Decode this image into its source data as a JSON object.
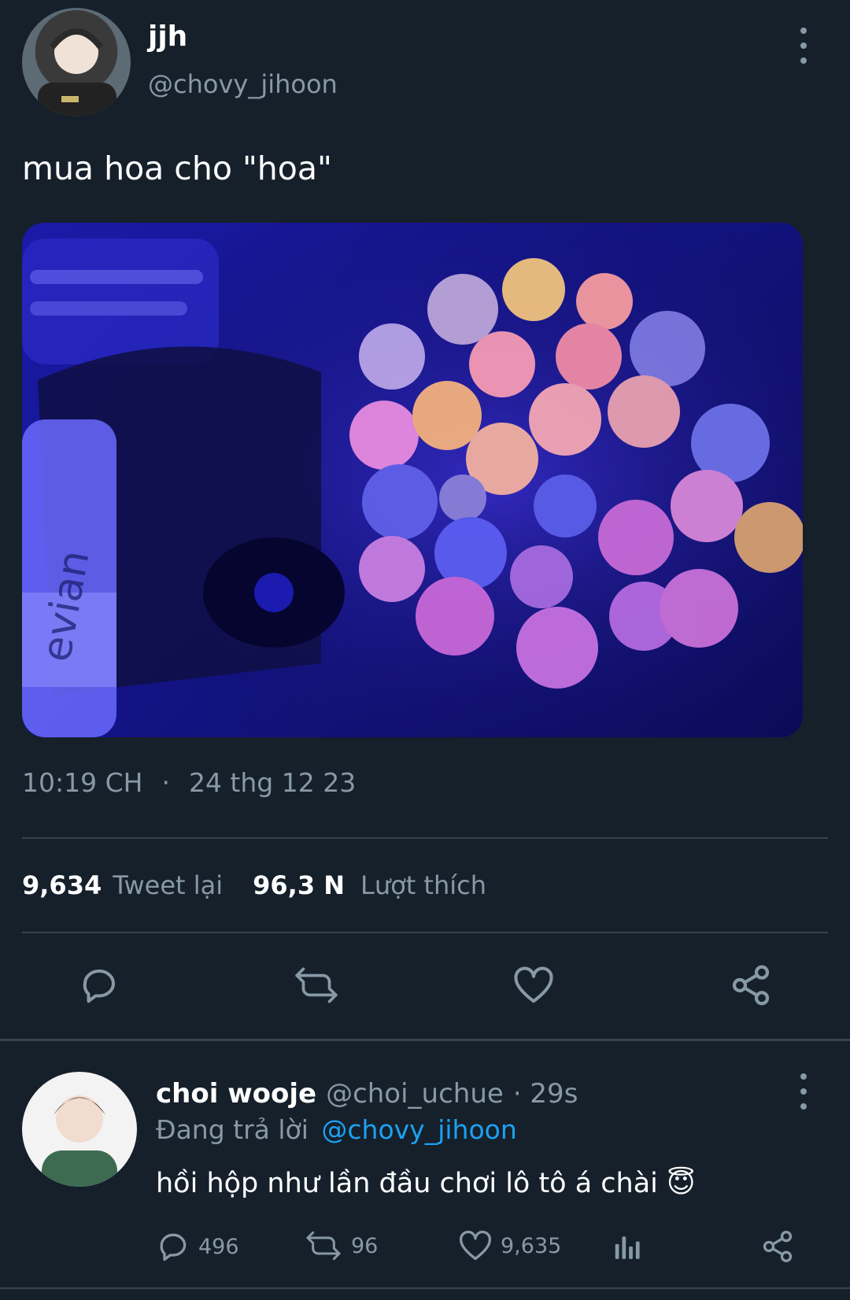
{
  "tweet": {
    "author_name": "jjh",
    "author_handle": "@chovy_jihoon",
    "text": "mua hoa cho \"hoa\"",
    "time": "10:19 CH",
    "separator": "·",
    "date": "24 thg 12 23",
    "retweets_count": "9,634",
    "retweets_label": "Tweet lại",
    "likes_count": "96,3 N",
    "likes_label": "Lượt thích"
  },
  "reply": {
    "author_name": "choi wooje",
    "author_handle": "@choi_uchue",
    "time": "· 29s",
    "replying_prefix": "Đang trả lời",
    "replying_to": "@chovy_jihoon",
    "text": "hồi hộp như lần đầu chơi lô tô á chài",
    "emoji": "😇",
    "reply_count": "496",
    "retweet_count": "96",
    "like_count": "9,635"
  },
  "colors": {
    "background": "#15202b",
    "muted": "#8899a6",
    "link": "#1da1f2",
    "divider": "#38444d"
  }
}
